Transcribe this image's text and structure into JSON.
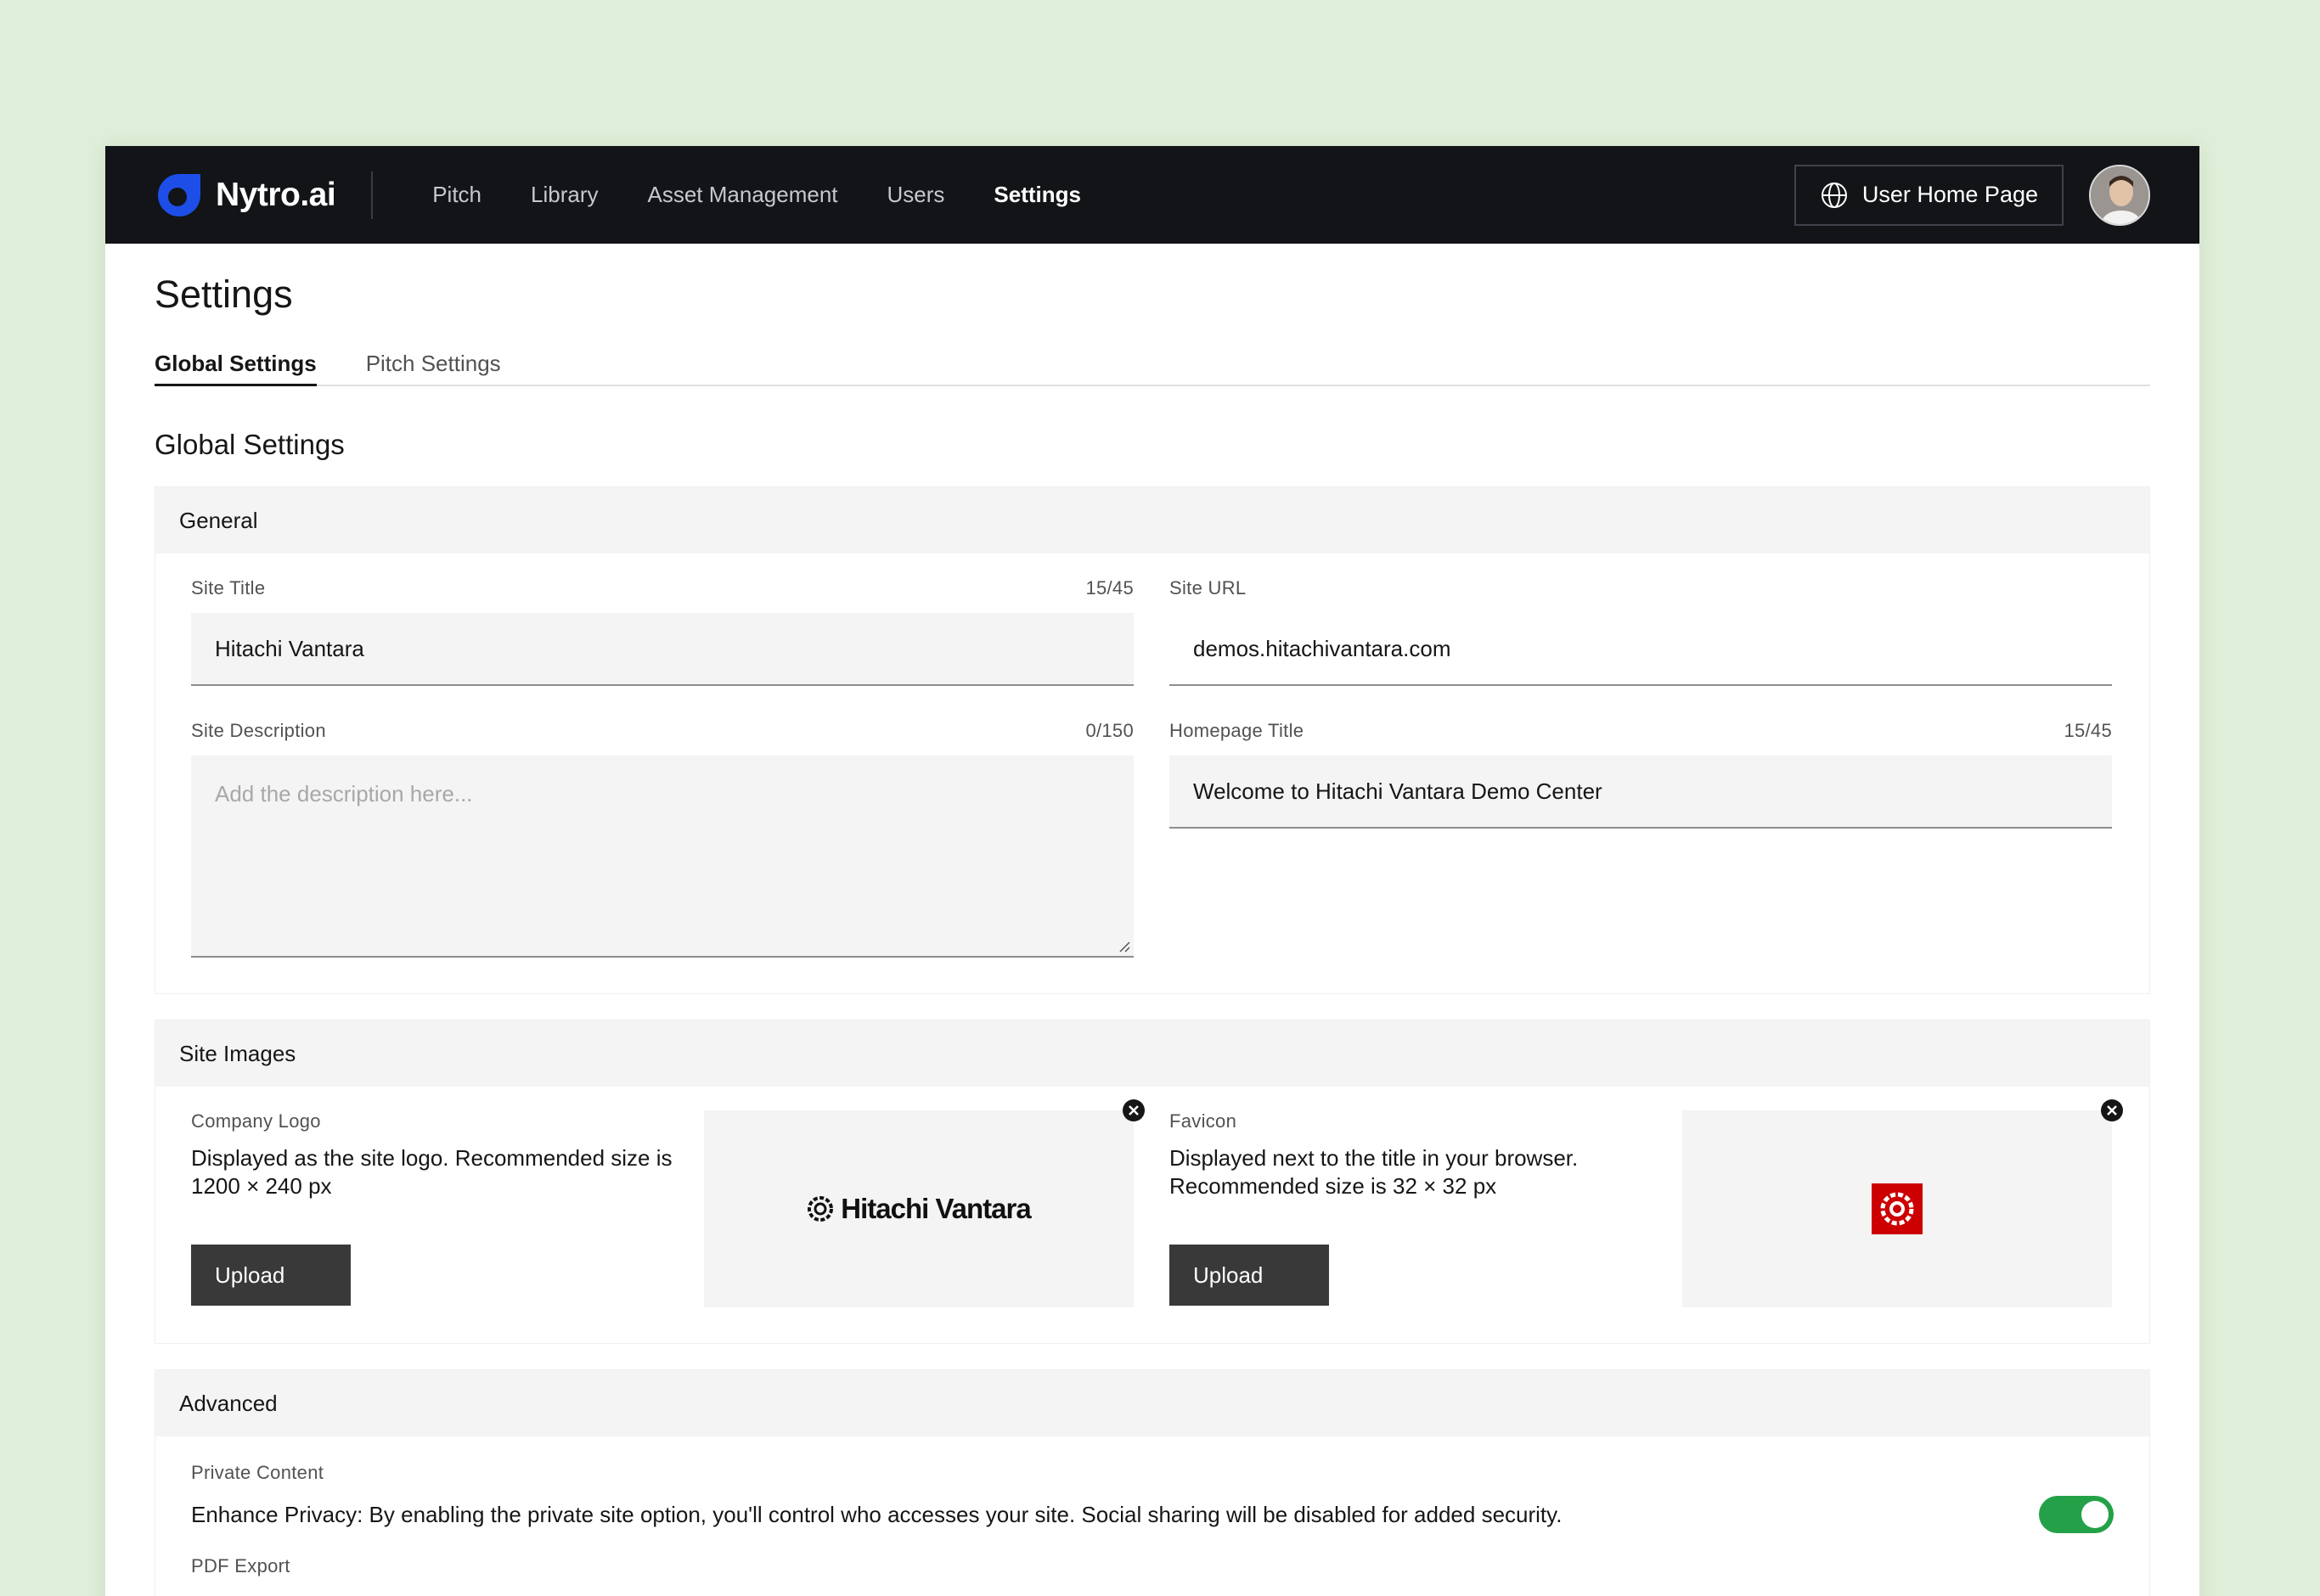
{
  "brand": {
    "name": "Nytro.ai",
    "accent": "#1d4ee8"
  },
  "nav": {
    "items": [
      {
        "label": "Pitch"
      },
      {
        "label": "Library"
      },
      {
        "label": "Asset Management"
      },
      {
        "label": "Users"
      },
      {
        "label": "Settings"
      }
    ],
    "home_button": "User Home Page"
  },
  "page": {
    "title": "Settings",
    "tabs": [
      {
        "label": "Global Settings"
      },
      {
        "label": "Pitch Settings"
      }
    ],
    "section_heading": "Global Settings"
  },
  "general": {
    "heading": "General",
    "site_title": {
      "label": "Site Title",
      "count": "15/45",
      "value": "Hitachi Vantara"
    },
    "site_url": {
      "label": "Site URL",
      "value": "demos.hitachivantara.com"
    },
    "site_description": {
      "label": "Site Description",
      "count": "0/150",
      "placeholder": "Add the description here..."
    },
    "homepage_title": {
      "label": "Homepage Title",
      "count": "15/45",
      "value": "Welcome to Hitachi Vantara Demo Center"
    }
  },
  "site_images": {
    "heading": "Site Images",
    "logo": {
      "label": "Company Logo",
      "description": "Displayed as the site logo. Recommended size is 1200 × 240 px",
      "upload": "Upload",
      "preview_text": "Hitachi Vantara"
    },
    "favicon": {
      "label": "Favicon",
      "description": "Displayed next to the title in your browser. Recommended size is 32 × 32 px",
      "upload": "Upload",
      "color": "#cc0000"
    }
  },
  "advanced": {
    "heading": "Advanced",
    "private_content": {
      "label": "Private Content",
      "description": "Enhance Privacy: By enabling the private site option, you'll control who accesses your site. Social sharing will be disabled for added security.",
      "enabled": true,
      "toggle_color": "#24a148"
    },
    "pdf_export": {
      "label": "PDF Export"
    }
  }
}
